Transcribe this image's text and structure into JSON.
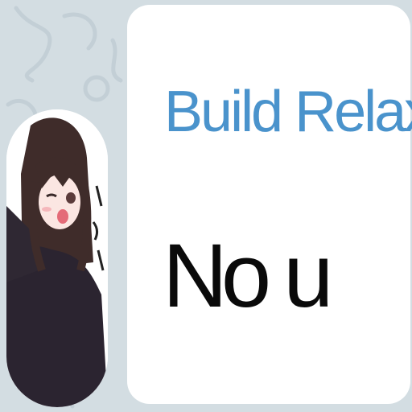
{
  "chat": {
    "background_color": "#d3dde2",
    "avatar_icon": "anime-girl-avatar",
    "message": {
      "sender_name": "Build Relax",
      "sender_color": "#4a93cc",
      "text": "No u"
    }
  }
}
